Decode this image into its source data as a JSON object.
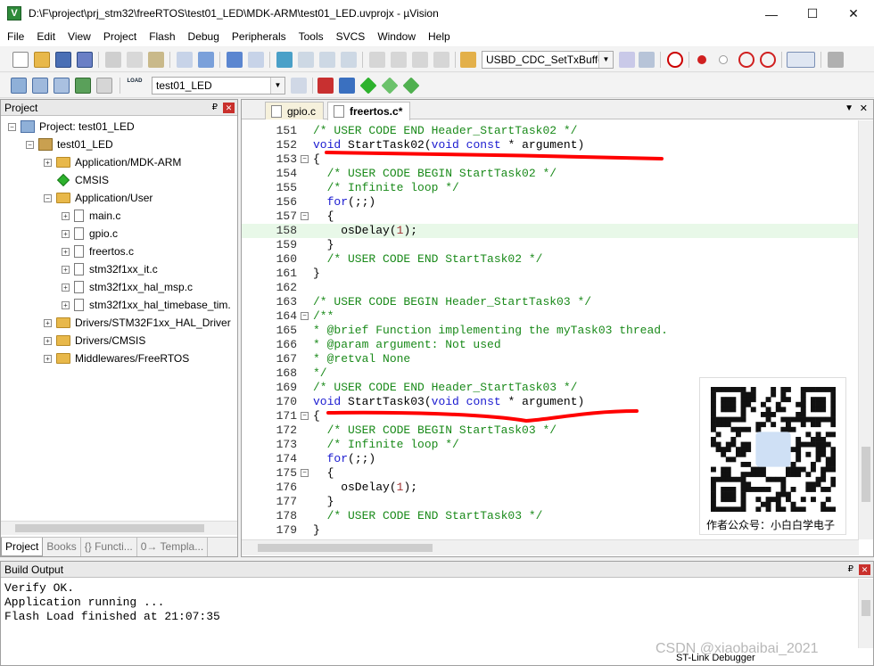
{
  "window": {
    "title": "D:\\F\\project\\prj_stm32\\freeRTOS\\test01_LED\\MDK-ARM\\test01_LED.uvprojx - µVision",
    "app_icon_letter": "V",
    "minimize": "—",
    "maximize": "☐",
    "close": "✕"
  },
  "menu": [
    "File",
    "Edit",
    "View",
    "Project",
    "Flash",
    "Debug",
    "Peripherals",
    "Tools",
    "SVCS",
    "Window",
    "Help"
  ],
  "toolbar1": {
    "function_combo": "USBD_CDC_SetTxBuffer"
  },
  "toolbar2": {
    "target_combo": "test01_LED",
    "load_label": "LOAD"
  },
  "project_panel": {
    "title": "Project",
    "pin": "₽",
    "close": "✕",
    "tree": {
      "root": "Project: test01_LED",
      "target": "test01_LED",
      "groups": [
        "Application/MDK-ARM",
        "CMSIS",
        "Application/User"
      ],
      "files": [
        "main.c",
        "gpio.c",
        "freertos.c",
        "stm32f1xx_it.c",
        "stm32f1xx_hal_msp.c",
        "stm32f1xx_hal_timebase_tim."
      ],
      "more_groups": [
        "Drivers/STM32F1xx_HAL_Driver",
        "Drivers/CMSIS",
        "Middlewares/FreeRTOS"
      ]
    },
    "expander_plus": "+",
    "expander_minus": "−",
    "bottom_tabs": [
      "Project",
      "Books",
      "{} Functi...",
      "0→ Templa..."
    ]
  },
  "editor": {
    "tabs": [
      "gpio.c",
      "freertos.c*"
    ],
    "tab_menu": "▼",
    "tab_close": "✕",
    "lines": [
      {
        "n": "151",
        "t": "/* USER CODE END Header_StartTask02 */",
        "k": "cm"
      },
      {
        "n": "152",
        "t": "void StartTask02(void const * argument)",
        "k": "fn"
      },
      {
        "n": "153",
        "t": "{",
        "k": "plain",
        "fold": "−"
      },
      {
        "n": "154",
        "t": "  /* USER CODE BEGIN StartTask02 */",
        "k": "cm"
      },
      {
        "n": "155",
        "t": "  /* Infinite loop */",
        "k": "cm"
      },
      {
        "n": "156",
        "t": "  for(;;)",
        "k": "for"
      },
      {
        "n": "157",
        "t": "  {",
        "k": "plain",
        "fold": "−"
      },
      {
        "n": "158",
        "t": "    osDelay(1);",
        "k": "delay",
        "hl": true
      },
      {
        "n": "159",
        "t": "  }",
        "k": "plain"
      },
      {
        "n": "160",
        "t": "  /* USER CODE END StartTask02 */",
        "k": "cm"
      },
      {
        "n": "161",
        "t": "}",
        "k": "plain"
      },
      {
        "n": "162",
        "t": "",
        "k": "plain"
      },
      {
        "n": "163",
        "t": "/* USER CODE BEGIN Header_StartTask03 */",
        "k": "cm"
      },
      {
        "n": "164",
        "t": "/**",
        "k": "cm",
        "fold": "−"
      },
      {
        "n": "165",
        "t": "* @brief Function implementing the myTask03 thread.",
        "k": "cm"
      },
      {
        "n": "166",
        "t": "* @param argument: Not used",
        "k": "cm"
      },
      {
        "n": "167",
        "t": "* @retval None",
        "k": "cm"
      },
      {
        "n": "168",
        "t": "*/",
        "k": "cm"
      },
      {
        "n": "169",
        "t": "/* USER CODE END Header_StartTask03 */",
        "k": "cm"
      },
      {
        "n": "170",
        "t": "void StartTask03(void const * argument)",
        "k": "fn"
      },
      {
        "n": "171",
        "t": "{",
        "k": "plain",
        "fold": "−"
      },
      {
        "n": "172",
        "t": "  /* USER CODE BEGIN StartTask03 */",
        "k": "cm"
      },
      {
        "n": "173",
        "t": "  /* Infinite loop */",
        "k": "cm"
      },
      {
        "n": "174",
        "t": "  for(;;)",
        "k": "for"
      },
      {
        "n": "175",
        "t": "  {",
        "k": "plain",
        "fold": "−"
      },
      {
        "n": "176",
        "t": "    osDelay(1);",
        "k": "delay"
      },
      {
        "n": "177",
        "t": "  }",
        "k": "plain"
      },
      {
        "n": "178",
        "t": "  /* USER CODE END StartTask03 */",
        "k": "cm"
      },
      {
        "n": "179",
        "t": "}",
        "k": "plain"
      }
    ]
  },
  "qr_overlay": {
    "caption": "作者公众号：小白白学电子"
  },
  "build_output": {
    "title": "Build Output",
    "pin": "₽",
    "close": "✕",
    "lines": [
      "Verify OK.",
      "Application running ...",
      "Flash Load finished at 21:07:35"
    ]
  },
  "watermark": "CSDN @xiaobaibai_2021",
  "status": {
    "debugger": "ST-Link Debugger"
  },
  "colors": {
    "comment": "#1a8a1a",
    "keyword": "#1a1ad0",
    "number": "#a03030",
    "highlight": "#e8f8e8",
    "annotation_red": "#ff0000"
  }
}
